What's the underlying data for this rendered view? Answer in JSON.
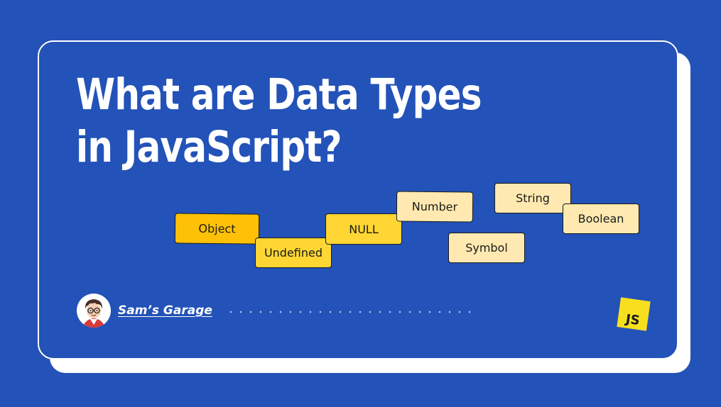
{
  "title": {
    "line1": "What are Data Types",
    "line2": "in JavaScript?"
  },
  "tags": [
    {
      "label": "Object"
    },
    {
      "label": "Undefined"
    },
    {
      "label": "NULL"
    },
    {
      "label": "Number"
    },
    {
      "label": "String"
    },
    {
      "label": "Boolean"
    },
    {
      "label": "Symbol"
    }
  ],
  "author": {
    "name": "Sam’s Garage",
    "avatar_icon": "cartoon-avatar-icon"
  },
  "logo": {
    "text": "JS",
    "icon": "javascript-logo-icon",
    "color": "#F7DF1E"
  },
  "colors": {
    "background": "#2352B8",
    "tag_dark": "#FFC107",
    "tag_mid": "#FFD633",
    "tag_light": "#FFE9B0"
  }
}
